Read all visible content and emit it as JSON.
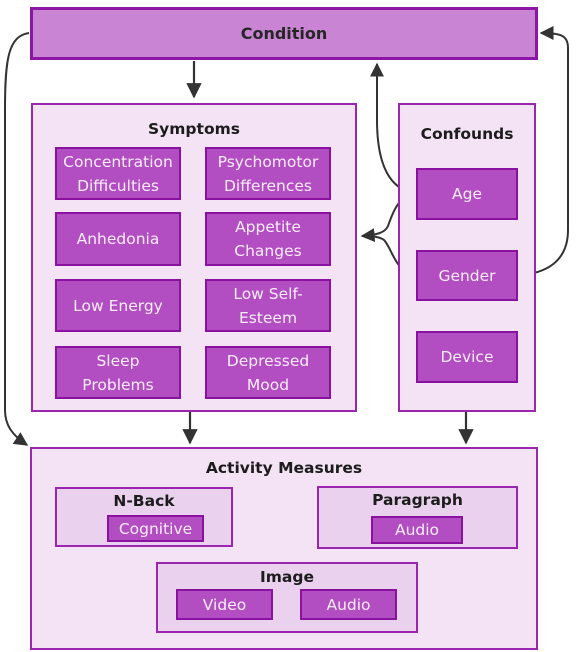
{
  "condition": {
    "label": "Condition"
  },
  "symptoms": {
    "title": "Symptoms",
    "items": [
      {
        "line1": "Concentration",
        "line2": "Difficulties"
      },
      {
        "line1": "Psychomotor",
        "line2": "Differences"
      },
      {
        "line1": "Anhedonia",
        "line2": ""
      },
      {
        "line1": "Appetite",
        "line2": "Changes"
      },
      {
        "line1": "Low Energy",
        "line2": ""
      },
      {
        "line1": "Low Self-",
        "line2": "Esteem"
      },
      {
        "line1": "Sleep",
        "line2": "Problems"
      },
      {
        "line1": "Depressed",
        "line2": "Mood"
      }
    ]
  },
  "confounds": {
    "title": "Confounds",
    "items": [
      "Age",
      "Gender",
      "Device"
    ]
  },
  "activity": {
    "title": "Activity Measures",
    "nback": {
      "title": "N-Back",
      "items": [
        "Cognitive"
      ]
    },
    "paragraph": {
      "title": "Paragraph",
      "items": [
        "Audio"
      ]
    },
    "image": {
      "title": "Image",
      "items": [
        "Video",
        "Audio"
      ]
    }
  },
  "colors": {
    "condition_fill": "#c985d4",
    "condition_border": "#8e16a6",
    "panel_fill": "#f4e3f5",
    "subpanel_fill": "#ead1ee",
    "leaf_fill": "#b24dc2",
    "border": "#9a26b0",
    "edge": "#333333"
  }
}
